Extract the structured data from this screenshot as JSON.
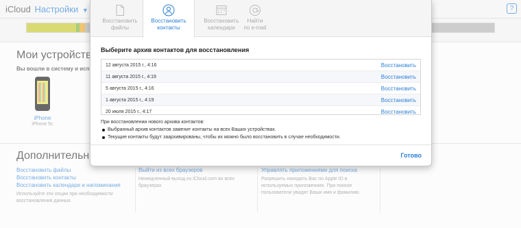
{
  "header": {
    "app": "iCloud",
    "section": "Настройки",
    "help": "?"
  },
  "storage": {
    "segments": [
      {
        "color": "#c6c62a",
        "fraction": 0.105
      },
      {
        "color": "#7ab23a",
        "fraction": 0.008
      },
      {
        "color": "#e8a722",
        "fraction": 0.012
      },
      {
        "color": "#b3b3b3",
        "fraction": 0.875
      }
    ]
  },
  "devices": {
    "title": "Мои устройства",
    "subtitle": "Вы вошли в систему и испо",
    "items": [
      {
        "name": "iPhone",
        "model": "iPhone 5c"
      }
    ]
  },
  "extra": {
    "title": "Дополнительны",
    "col1": {
      "links": [
        "Восстановить файлы",
        "Восстановить контакты",
        "Восстановить календари и напоминания"
      ],
      "note": "Используйте эти опции при необходимости восстановления данных."
    },
    "col2": {
      "links": [
        "Выйти из всех браузеров"
      ],
      "note": "Немедленный выход из iCloud.com во всех браузерах"
    },
    "col3": {
      "links": [
        "Управлять приложениями для поиска"
      ],
      "note": "Разрешить находить Вас по Apple ID в используемых приложениях. При поиске пользователи увидят Ваши имя и фамилию."
    }
  },
  "modal": {
    "tabs": [
      {
        "line1": "Восстановить",
        "line2": "файлы",
        "icon": "file-icon",
        "active": false
      },
      {
        "line1": "Восстановить",
        "line2": "контакты",
        "icon": "contact-icon",
        "active": true
      },
      {
        "line1": "Восстановить",
        "line2": "календари",
        "icon": "calendar-icon",
        "active": false
      },
      {
        "line1": "Найти",
        "line2": "по e-mail",
        "icon": "at-icon",
        "active": false
      }
    ],
    "heading": "Выберите архив контактов для восстановления",
    "restore_label": "Восстановить",
    "archives": [
      "12 августа 2015 г., 4:16",
      "11 августа 2015 г., 4:19",
      "5 августа 2015 г., 4:16",
      "1 августа 2015 г., 4:19",
      "20 июля 2015 г., 4:17"
    ],
    "info_title": "При восстановлении нового архива контактов:",
    "info_bullets": [
      "Выбранный архив контактов заменит контакты на всех Ваших устройствах.",
      "Текущие контакты будут заархивированы, чтобы их можно было восстановить в случае необходимости."
    ],
    "done": "Готово"
  },
  "colors": {
    "accent": "#2b7fd6"
  }
}
